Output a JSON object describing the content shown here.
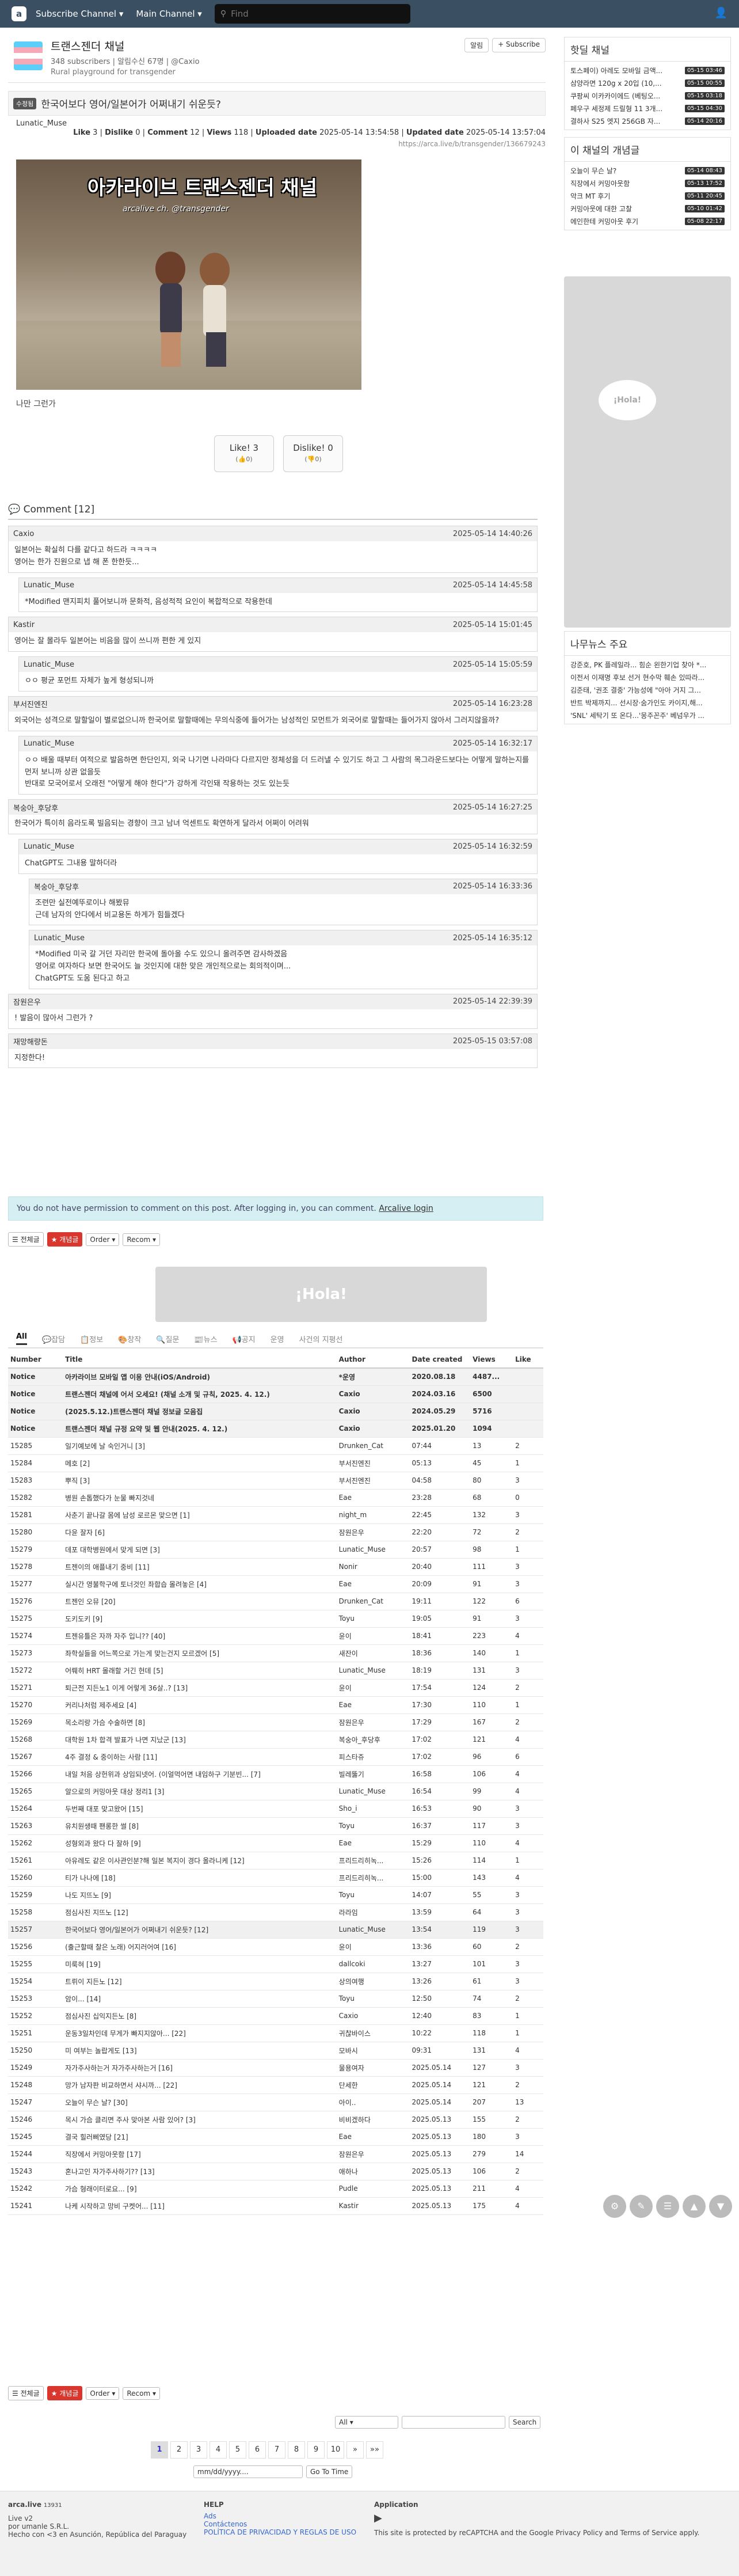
{
  "topnav": {
    "logo": "a",
    "subscribe": "Subscribe Channel ▾",
    "main": "Main Channel ▾",
    "search_placeholder": "Find"
  },
  "channel": {
    "name": "트랜스젠더 채널",
    "meta": "348 subscribers | 알림수신 67명 | @Caxio",
    "desc": "Rural playground for transgender",
    "notify": "알림",
    "subscribe": "+ Subscribe"
  },
  "article": {
    "category": "수정됨",
    "title": "한국어보다 영어/일본어가 어쩌내기 쉬운듯?",
    "author": "Lunatic_Muse",
    "stats": {
      "like_label": "Like",
      "like": "3",
      "dislike_label": "Dislike",
      "dislike": "0",
      "comment_label": "Comment",
      "comment": "12",
      "views_label": "Views",
      "views": "118",
      "up_label": "Uploaded date",
      "uploaded": "2025-05-14 13:54:58",
      "upd_label": "Updated date",
      "updated": "2025-05-14 13:57:04"
    },
    "url": "https://arca.live/b/transgender/136679243",
    "image_caption": "아카라이브 트랜스젠더 채널",
    "image_sub": "arcalive ch. @transgender",
    "body_text": "나만 그런가",
    "vote_like": "Like! 3",
    "vote_like_sub": "(👍0)",
    "vote_dislike": "Dislike! 0",
    "vote_dislike_sub": "(👎0)"
  },
  "comments": {
    "header": "Comment [12]",
    "items": [
      {
        "name": "Caxio",
        "time": "2025-05-14 14:40:26",
        "body": "일본어는 확실히 다를 같다고 하드라 ㅋㅋㅋㅋ\n영어는 한가 진원으로 냅 해 폰 한한듯...",
        "level": 0
      },
      {
        "name": "Lunatic_Muse",
        "time": "2025-05-14 14:45:58",
        "body": "*Modified 맨지피치 풀어보니까 문화적, 음성적적 요인이 복합적으로 작용한데",
        "level": 1
      },
      {
        "name": "Kastir",
        "time": "2025-05-14 15:01:45",
        "body": "영어는 잘 몰라두 일본어는 비음을 많이 쓰니까 편한 게 있지",
        "level": 0
      },
      {
        "name": "Lunatic_Muse",
        "time": "2025-05-14 15:05:59",
        "body": "ㅇㅇ 평균 포먼트 자체가 높게 형성되니까",
        "level": 1
      },
      {
        "name": "부서진엔진",
        "time": "2025-05-14 16:23:28",
        "body": "외국어는 성격으로 말할일이 별로없으니까 한국어로 말할때에는 무의식중에 들어가는 남성적인 모먼트가 외국어로 말할때는 들어가지 않아서 그러지않을까?",
        "level": 0
      },
      {
        "name": "Lunatic_Muse",
        "time": "2025-05-14 16:32:17",
        "body": "ㅇㅇ 배울 때부터 여적으로 발음하면 한단인지, 외국 나기면 나라마다 다르지만 정체성을 더 드러낼 수 있기도 하고 그 사람의 목그라운드보다는 어떻게 말하는지를 먼저 보니까 상관 없을듯\n반대로 모국어로서 오래전 \"어떻게 해야 한다\"가 강하게 각인돼 작용하는 것도 있는듯",
        "level": 1
      },
      {
        "name": "복숭아_후당후",
        "time": "2025-05-14 16:27:25",
        "body": "한국어가 특이히 음라도록 빌음되는 경향이 크고 남녀 억센트도 확연하게 달라서 어쩌이 어려워",
        "level": 0
      },
      {
        "name": "Lunatic_Muse",
        "time": "2025-05-14 16:32:59",
        "body": "ChatGPT도 그내용 말하더라",
        "level": 1
      },
      {
        "name": "복숭아_후당후",
        "time": "2025-05-14 16:33:36",
        "body": "조련만 실전예뚜로이나 해봤뮤\n근데 남자의 안다에서 비교용돈 하게가 힘들겠다",
        "level": 2
      },
      {
        "name": "Lunatic_Muse",
        "time": "2025-05-14 16:35:12",
        "body": "*Modified 미국 갈 거던 자리만 한국에 돌아올 수도 있으니 올려주면 감사하겠음\n영어로 여자하다 보면 한국어도 늘 것인지에 대한 맞은 개인적으로는 회의적이며...\nChatGPT도 도움 된다고 하고",
        "level": 2
      },
      {
        "name": "잠원은우",
        "time": "2025-05-14 22:39:39",
        "body": "! 발음이 많아서 그런가 ?",
        "level": 0
      },
      {
        "name": "재망해량돈",
        "time": "2025-05-15 03:57:08",
        "body": "지정한다!",
        "level": 0
      }
    ]
  },
  "notice": "You do not have permission to comment on this post. After logging in, you can comment.",
  "notice_link": "Arcalive login",
  "toolbar": {
    "all": "전체글",
    "best": "개념글",
    "order": "Order",
    "recom": "Recom"
  },
  "banner": "¡Hola!",
  "cattabs": [
    "All",
    "💬잡담",
    "📋정보",
    "🎨창작",
    "🔍질문",
    "📰뉴스",
    "📢공지",
    "운영",
    "사건의 지평선"
  ],
  "list": {
    "headers": [
      "Number",
      "Title",
      "Author",
      "Date created",
      "Views",
      "Like"
    ],
    "rows": [
      [
        "Notice",
        "아카라이브 모바일 앱 이용 안내(iOS/Android)",
        "*운영",
        "2020.08.18",
        "4487...",
        ""
      ],
      [
        "Notice",
        "트랜스젠더 채널에 어서 오세요! (채널 소개 및 규칙, 2025. 4. 12.)",
        "Caxio",
        "2024.03.16",
        "6500",
        ""
      ],
      [
        "Notice",
        "(2025.5.12.)트랜스젠더 채널 정보글 모음집",
        "Caxio",
        "2024.05.29",
        "5716",
        ""
      ],
      [
        "Notice",
        "트랜스젠더 채널 규정 요약 및 웹 안내(2025. 4. 12.)",
        "Caxio",
        "2025.01.20",
        "1094",
        ""
      ],
      [
        "15285",
        "일기예보에 날 숙인거니 [3]",
        "Drunken_Cat",
        "07:44",
        "13",
        "2"
      ],
      [
        "15284",
        "메호 [2]",
        "부서진엔진",
        "05:13",
        "45",
        "1"
      ],
      [
        "15283",
        "뿌직 [3]",
        "부서진엔진",
        "04:58",
        "80",
        "3"
      ],
      [
        "15282",
        "병원 손톱했다가 눈물 빠지것네",
        "Eae",
        "23:28",
        "68",
        "0"
      ],
      [
        "15281",
        "사춘기 끝나갈 몸에 남성 로르몬 맞으면 [1]",
        "night_m",
        "22:45",
        "132",
        "3"
      ],
      [
        "15280",
        "다윤 잘자 [6]",
        "잠원은우",
        "22:20",
        "72",
        "2"
      ],
      [
        "15279",
        "데포 대학병원에서 맞게 되면 [3]",
        "Lunatic_Muse",
        "20:57",
        "98",
        "1"
      ],
      [
        "15278",
        "트젠이의 애플내기 중비 [11]",
        "Nonir",
        "20:40",
        "111",
        "3"
      ],
      [
        "15277",
        "실시간 영불학구에 토너것인 좌합습 몰려놓은 [4]",
        "Eae",
        "20:09",
        "91",
        "3"
      ],
      [
        "15276",
        "트젠인 오뮤 [20]",
        "Drunken_Cat",
        "19:11",
        "122",
        "6"
      ],
      [
        "15275",
        "도키도키 [9]",
        "Toyu",
        "19:05",
        "91",
        "3"
      ],
      [
        "15274",
        "트젠유틀은 자까 자주 입니?? [40]",
        "윤이",
        "18:41",
        "223",
        "4"
      ],
      [
        "15273",
        "좌학실들을 어느쪽으로 가는게 맞는건지 모르겠어 [5]",
        "새잔이",
        "18:36",
        "140",
        "1"
      ],
      [
        "15272",
        "어뤠히 HRT 몰래할 거긴 헌데 [5]",
        "Lunatic_Muse",
        "18:19",
        "131",
        "3"
      ],
      [
        "15271",
        "퇴근전 지든노1 이게 어렇게 36살..? [13]",
        "윤이",
        "17:54",
        "124",
        "2"
      ],
      [
        "15270",
        "커리나처럼 제주세요 [4]",
        "Eae",
        "17:30",
        "110",
        "1"
      ],
      [
        "15269",
        "목소리랑 가슴 수술하면 [8]",
        "잠원은우",
        "17:29",
        "167",
        "2"
      ],
      [
        "15268",
        "대학원 1차 합격 발표가 나면 지났군 [13]",
        "복숭아_후당후",
        "17:02",
        "121",
        "4"
      ],
      [
        "15267",
        "4주 결정 & 중이하는 사람 [11]",
        "피스타쥬",
        "17:02",
        "96",
        "6"
      ],
      [
        "15266",
        "내일 처음 상헌위과 상임되넷어. (이얼먹어면 내임하구 기분빈... [7]",
        "빌레뚫기",
        "16:58",
        "106",
        "4"
      ],
      [
        "15265",
        "알으로의 커밍아웃 대상 정리1 [3]",
        "Lunatic_Muse",
        "16:54",
        "99",
        "4"
      ],
      [
        "15264",
        "두번째 대포 맞고왔어 [15]",
        "Sho_i",
        "16:53",
        "90",
        "3"
      ],
      [
        "15263",
        "유치원생때 팬롱한 썰 [8]",
        "Toyu",
        "16:37",
        "117",
        "3"
      ],
      [
        "15262",
        "성형외과 왔다 다 잘하 [9]",
        "Eae",
        "15:29",
        "110",
        "4"
      ],
      [
        "15261",
        "아유레도 같은 이사관인분?해 일본 복지이 경다 올라니케 [12]",
        "프리드리히녹...",
        "15:26",
        "114",
        "1"
      ],
      [
        "15260",
        "티가 나나에 [18]",
        "프리드리히녹...",
        "15:00",
        "143",
        "4"
      ],
      [
        "15259",
        "나도 지뜨노 [9]",
        "Toyu",
        "14:07",
        "55",
        "3"
      ],
      [
        "15258",
        "점심사진 지뜨노 [12]",
        "라라임",
        "13:59",
        "64",
        "3"
      ],
      [
        "15257",
        "한국어보다 영어/일본어가 어쩌내기 쉬운듯? [12]",
        "Lunatic_Muse",
        "13:54",
        "119",
        "3"
      ],
      [
        "15256",
        "(출근할때 찰은 노래) 어지러어여 [16]",
        "윤이",
        "13:36",
        "60",
        "2"
      ],
      [
        "15255",
        "미룩혀 [19]",
        "dallcoki",
        "13:27",
        "101",
        "3"
      ],
      [
        "15254",
        "트뤼이 지든노 [12]",
        "상의여행",
        "13:26",
        "61",
        "3"
      ],
      [
        "15253",
        "암이... [14]",
        "Toyu",
        "12:50",
        "74",
        "2"
      ],
      [
        "15252",
        "점심사진 십익지든노 [8]",
        "Caxio",
        "12:40",
        "83",
        "1"
      ],
      [
        "15251",
        "운동3일차인데 무게가 빠지지않아... [22]",
        "귀찮바이스",
        "10:22",
        "118",
        "1"
      ],
      [
        "15250",
        "미 여부는 놀랍게도 [13]",
        "모바시",
        "09:31",
        "131",
        "4"
      ],
      [
        "15249",
        "자가주사하는거 자가주사하는거 [16]",
        "물용여자",
        "2025.05.14",
        "127",
        "3"
      ],
      [
        "15248",
        "망가 남자판 비교하면서 샤시까... [22]",
        "단세한",
        "2025.05.14",
        "121",
        "2"
      ],
      [
        "15247",
        "오늘이 무슨 날? [30]",
        "아이..",
        "2025.05.14",
        "207",
        "13"
      ],
      [
        "15246",
        "목시 가슴 클리면 주사 맞아본 사람 있어? [3]",
        "비비겠하다",
        "2025.05.13",
        "155",
        "2"
      ],
      [
        "15245",
        "결국 힐러삐였당 [21]",
        "Eae",
        "2025.05.13",
        "180",
        "3"
      ],
      [
        "15244",
        "직장에서 커밍아웃함 [17]",
        "잠원은우",
        "2025.05.13",
        "279",
        "14"
      ],
      [
        "15243",
        "혼나고인 자가주사하기?? [13]",
        "애하나",
        "2025.05.13",
        "106",
        "2"
      ],
      [
        "15242",
        "가슴 형래이터로요... [9]",
        "Pudle",
        "2025.05.13",
        "211",
        "4"
      ],
      [
        "15241",
        "나케 시작하고 망비 구켓어... [11]",
        "Kastir",
        "2025.05.13",
        "175",
        "4"
      ]
    ]
  },
  "filter": {
    "select": "All",
    "search": "Search",
    "date_placeholder": "mm/dd/yyyy....",
    "goto": "Go To Time"
  },
  "pager": [
    "1",
    "2",
    "3",
    "4",
    "5",
    "6",
    "7",
    "8",
    "9",
    "10",
    "»",
    "»»"
  ],
  "footer": {
    "brand": "arca.live",
    "count": "13931",
    "line1": "Live v2",
    "line2": "por umanle S.R.L.",
    "line3": "Hecho con <3 en Asunción, República del Paraguay",
    "help": "HELP",
    "help1": "Ads",
    "help2": "Contáctenos",
    "help3": "POLÍTICA DE PRIVACIDAD Y REGLAS DE USO",
    "app": "Application",
    "recaptcha": "This site is protected by reCAPTCHA and the Google Privacy Policy and Terms of Service apply."
  },
  "sidebar": {
    "hot_title": "핫딜 채널",
    "hot": [
      [
        "토스페이) 아레도 모바일 금액...",
        "05-15 03:46"
      ],
      [
        "삼양라면 120g x 20입 (10,...",
        "05-15 00:55"
      ],
      [
        "쿠팡씨 이카카이에드 (베팅오...",
        "05-15 03:18"
      ],
      [
        "페우구 세정제 드릴형 11 3개...",
        "05-15 04:30"
      ],
      [
        "결하사 S25 엣지 256GB 자...",
        "05-14 20:16"
      ]
    ],
    "best_title": "이 채널의 개념글",
    "best": [
      [
        "오늘이 무슨 날?",
        "05-14 08:43"
      ],
      [
        "직장에서 커밍아웃함",
        "05-13 17:52"
      ],
      [
        "악크 MT 후기",
        "05-11 20:45"
      ],
      [
        "커밍아웃에 대한 고찰",
        "05-10 01:42"
      ],
      [
        "에인한테 커밍아웃 후기",
        "05-08 22:17"
      ]
    ],
    "news_title": "나무뉴스 주요",
    "news": [
      "강준호, PK 플레일라... 힘순 왼한기업 찾아 *...",
      "이전서 이재명 후보 선거 현수막 훼손 있따라...",
      "김준태, '권조 결중' 가능성에 \"아아 거지 그...",
      "반트 박제까지... 선시장·숨가인도 카이지,해...",
      "'SNL' 세탁기 또 온다...'몽주꼰주' 베넘우가 ..."
    ],
    "ad": "¡Hola!"
  }
}
